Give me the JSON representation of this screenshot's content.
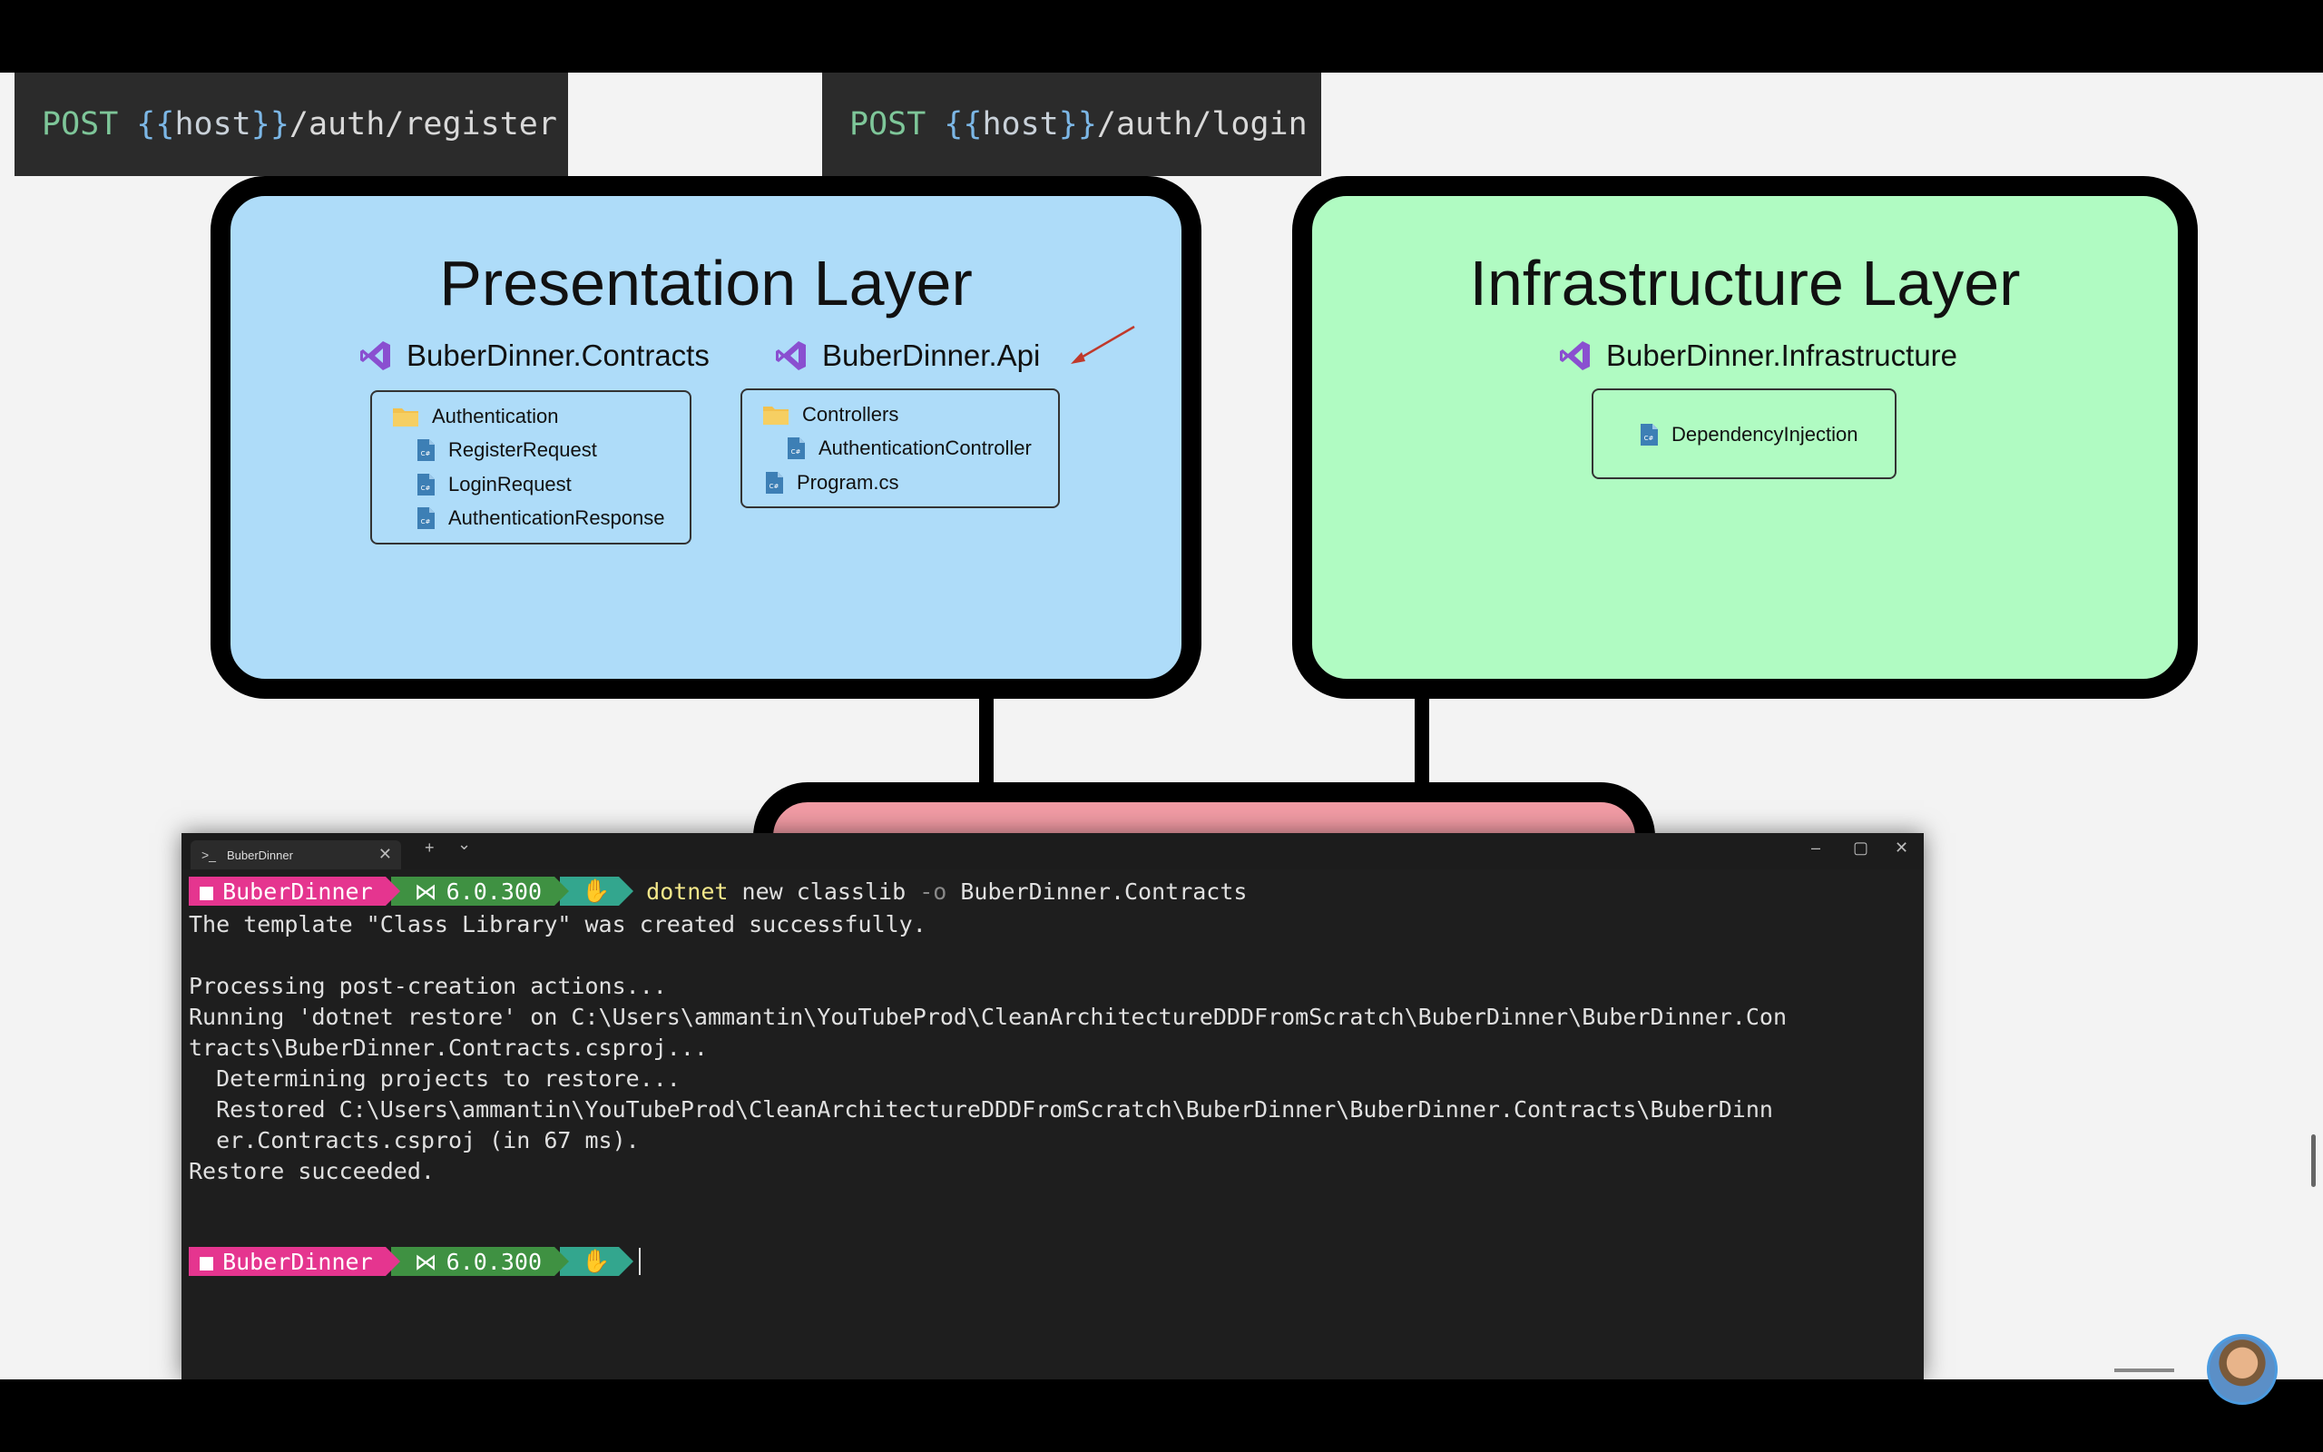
{
  "http": {
    "register": {
      "verb": "POST",
      "host_open": "{{",
      "host_var": "host",
      "host_close": "}}",
      "path": "/auth/register"
    },
    "login": {
      "verb": "POST",
      "host_open": "{{",
      "host_var": "host",
      "host_close": "}}",
      "path": "/auth/login"
    }
  },
  "presentation": {
    "title": "Presentation Layer",
    "contracts": {
      "name": "BuberDinner.Contracts",
      "folder": "Authentication",
      "files": [
        "RegisterRequest",
        "LoginRequest",
        "AuthenticationResponse"
      ]
    },
    "api": {
      "name": "BuberDinner.Api",
      "folder": "Controllers",
      "folder_file": "AuthenticationController",
      "root_file": "Program.cs"
    }
  },
  "infrastructure": {
    "title": "Infrastructure Layer",
    "name": "BuberDinner.Infrastructure",
    "files": [
      "DependencyInjection"
    ]
  },
  "terminal": {
    "tab_title": "BuberDinner",
    "new_tab": "+",
    "dropdown": "⌄",
    "minimize": "–",
    "maximize": "▢",
    "close": "✕",
    "prompt": {
      "dir": "BuberDinner",
      "dotnet_version": "6.0.300"
    },
    "command": {
      "exe": "dotnet",
      "pre_flag": "new classlib",
      "flag": "-o",
      "arg": "BuberDinner.Contracts"
    },
    "output": [
      "The template \"Class Library\" was created successfully.",
      "",
      "Processing post-creation actions...",
      "Running 'dotnet restore' on C:\\Users\\ammantin\\YouTubeProd\\CleanArchitectureDDDFromScratch\\BuberDinner\\BuberDinner.Con",
      "tracts\\BuberDinner.Contracts.csproj...",
      "  Determining projects to restore...",
      "  Restored C:\\Users\\ammantin\\YouTubeProd\\CleanArchitectureDDDFromScratch\\BuberDinner\\BuberDinner.Contracts\\BuberDinn",
      "  er.Contracts.csproj (in 67 ms).",
      "Restore succeeded."
    ]
  },
  "colors": {
    "presentation_fill": "#aedcf9",
    "infrastructure_fill": "#b0fbc2",
    "domain_fill": "#f19ba4",
    "prompt_dir": "#e5358f",
    "prompt_version": "#3f9142",
    "prompt_hand": "#33a68e"
  },
  "icons": [
    "visual-studio-icon",
    "folder-icon",
    "csharp-file-icon",
    "terminal-icon",
    "hand-icon",
    "folder-segment-icon"
  ]
}
